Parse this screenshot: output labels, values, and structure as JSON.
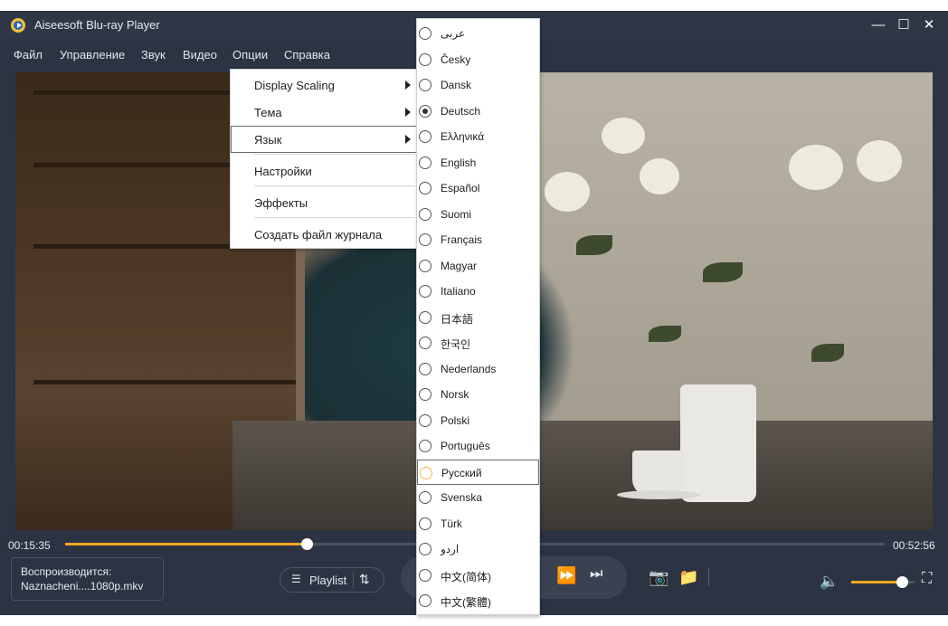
{
  "app": {
    "title": "Aiseesoft Blu-ray Player"
  },
  "window_controls": {
    "minimize": "—",
    "maximize": "☐",
    "close": "✕"
  },
  "menubar": {
    "items": [
      "Файл",
      "Управление",
      "Звук",
      "Видео",
      "Опции",
      "Справка"
    ]
  },
  "options_menu": {
    "items": [
      {
        "label": "Display Scaling",
        "submenu": true
      },
      {
        "label": "Тема",
        "submenu": true
      },
      {
        "label": "Язык",
        "submenu": true,
        "highlighted": true
      },
      {
        "label": "Настройки",
        "submenu": false
      },
      {
        "label": "Эффекты",
        "submenu": false
      },
      {
        "label": "Создать файл журнала",
        "submenu": false
      }
    ]
  },
  "language_menu": {
    "selected": "Deutsch",
    "hovered": "Русский",
    "items": [
      "عربى",
      "Česky",
      "Dansk",
      "Deutsch",
      "Ελληνικά",
      "English",
      "Español",
      "Suomi",
      "Français",
      "Magyar",
      "Italiano",
      "日本語",
      "한국인",
      "Nederlands",
      "Norsk",
      "Polski",
      "Português",
      "Русский",
      "Svenska",
      "Türk",
      "اردو",
      "中文(简体)",
      "中文(繁體)"
    ]
  },
  "player": {
    "elapsed": "00:15:35",
    "duration": "00:52:56",
    "progress_percent": 29.5,
    "now_playing_label": "Воспроизводится:",
    "now_playing_file": "Naznacheni....1080p.mkv",
    "playlist_label": "Playlist",
    "volume_percent": 80
  },
  "colors": {
    "accent": "#f5a623",
    "background": "#2c3443"
  }
}
